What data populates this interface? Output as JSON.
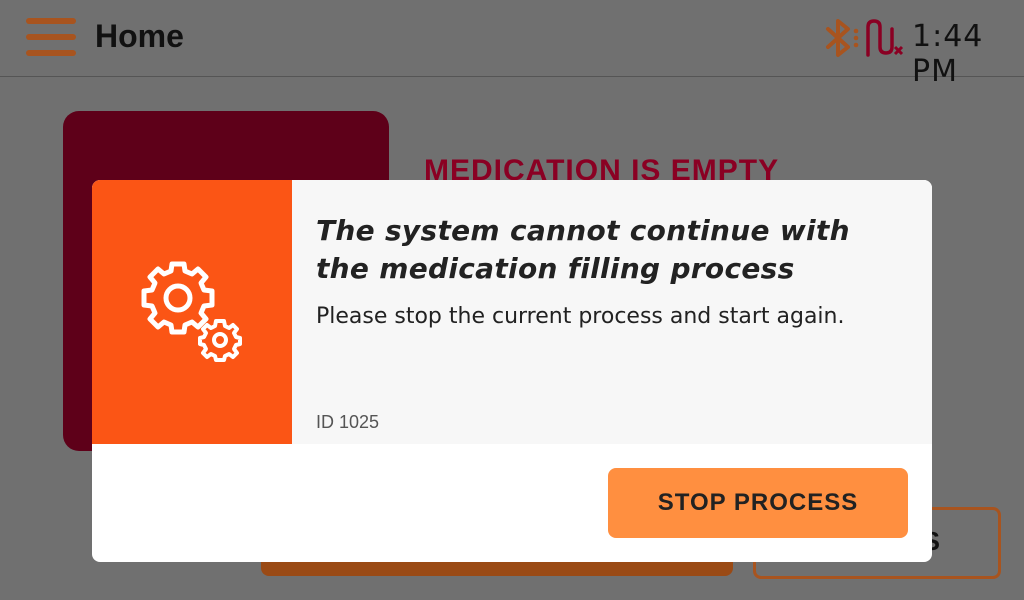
{
  "header": {
    "title": "Home",
    "time": "1:44 PM",
    "icons": [
      "menu-icon",
      "bluetooth-off-icon",
      "signal-off-icon"
    ]
  },
  "background": {
    "heading": "MEDICATION IS EMPTY",
    "outline_button_label": "S"
  },
  "dialog": {
    "icon": "gears-icon",
    "title": "The system cannot continue with the medication filling process",
    "message": "Please stop the current process and start again.",
    "id": "ID 1025",
    "stop_label": "STOP PROCESS"
  },
  "colors": {
    "accent": "#fb5515",
    "button": "#ff8f40",
    "brand_dark": "#5e0019",
    "menu": "#a8541f"
  }
}
